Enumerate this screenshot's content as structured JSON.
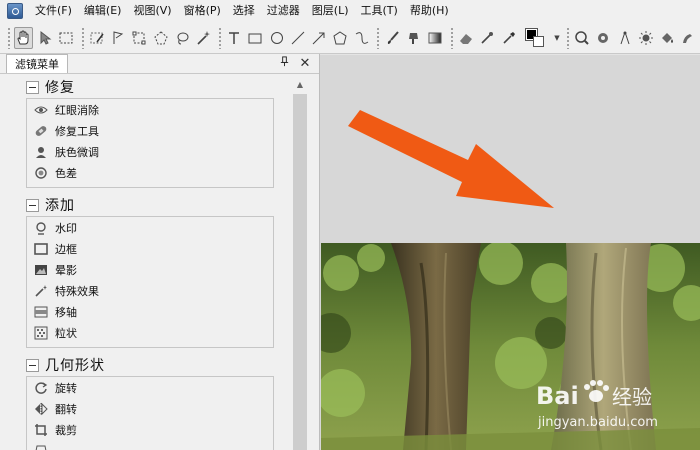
{
  "menubar": {
    "items": [
      "文件(F)",
      "编辑(E)",
      "视图(V)",
      "窗格(P)",
      "选择",
      "过滤器",
      "图层(L)",
      "工具(T)",
      "帮助(H)"
    ]
  },
  "toolbar": {
    "foreground_color": "#000000",
    "background_color": "#ffffff"
  },
  "panel": {
    "tab_label": "滤镜菜单",
    "pin_glyph": "📌",
    "close_glyph": "✕",
    "sections": [
      {
        "title": "修复",
        "items": [
          {
            "label": "红眼消除",
            "icon": "eye-icon"
          },
          {
            "label": "修复工具",
            "icon": "bandage-icon"
          },
          {
            "label": "肤色微调",
            "icon": "person-icon"
          },
          {
            "label": "色差",
            "icon": "aberration-icon"
          }
        ]
      },
      {
        "title": "添加",
        "items": [
          {
            "label": "水印",
            "icon": "watermark-icon"
          },
          {
            "label": "边框",
            "icon": "frame-icon"
          },
          {
            "label": "晕影",
            "icon": "vignette-icon"
          },
          {
            "label": "特殊效果",
            "icon": "magic-wand-icon"
          },
          {
            "label": "移轴",
            "icon": "tilt-shift-icon"
          },
          {
            "label": "粒状",
            "icon": "grain-icon"
          }
        ]
      },
      {
        "title": "几何形状",
        "items": [
          {
            "label": "旋转",
            "icon": "rotate-icon"
          },
          {
            "label": "翻转",
            "icon": "flip-icon"
          },
          {
            "label": "裁剪",
            "icon": "crop-icon"
          }
        ]
      }
    ]
  },
  "canvas": {
    "annotation_arrow_color": "#f05a14"
  },
  "watermark": {
    "brand": "Bai",
    "brand_suffix": "经验",
    "url": "jingyan.baidu.com"
  }
}
